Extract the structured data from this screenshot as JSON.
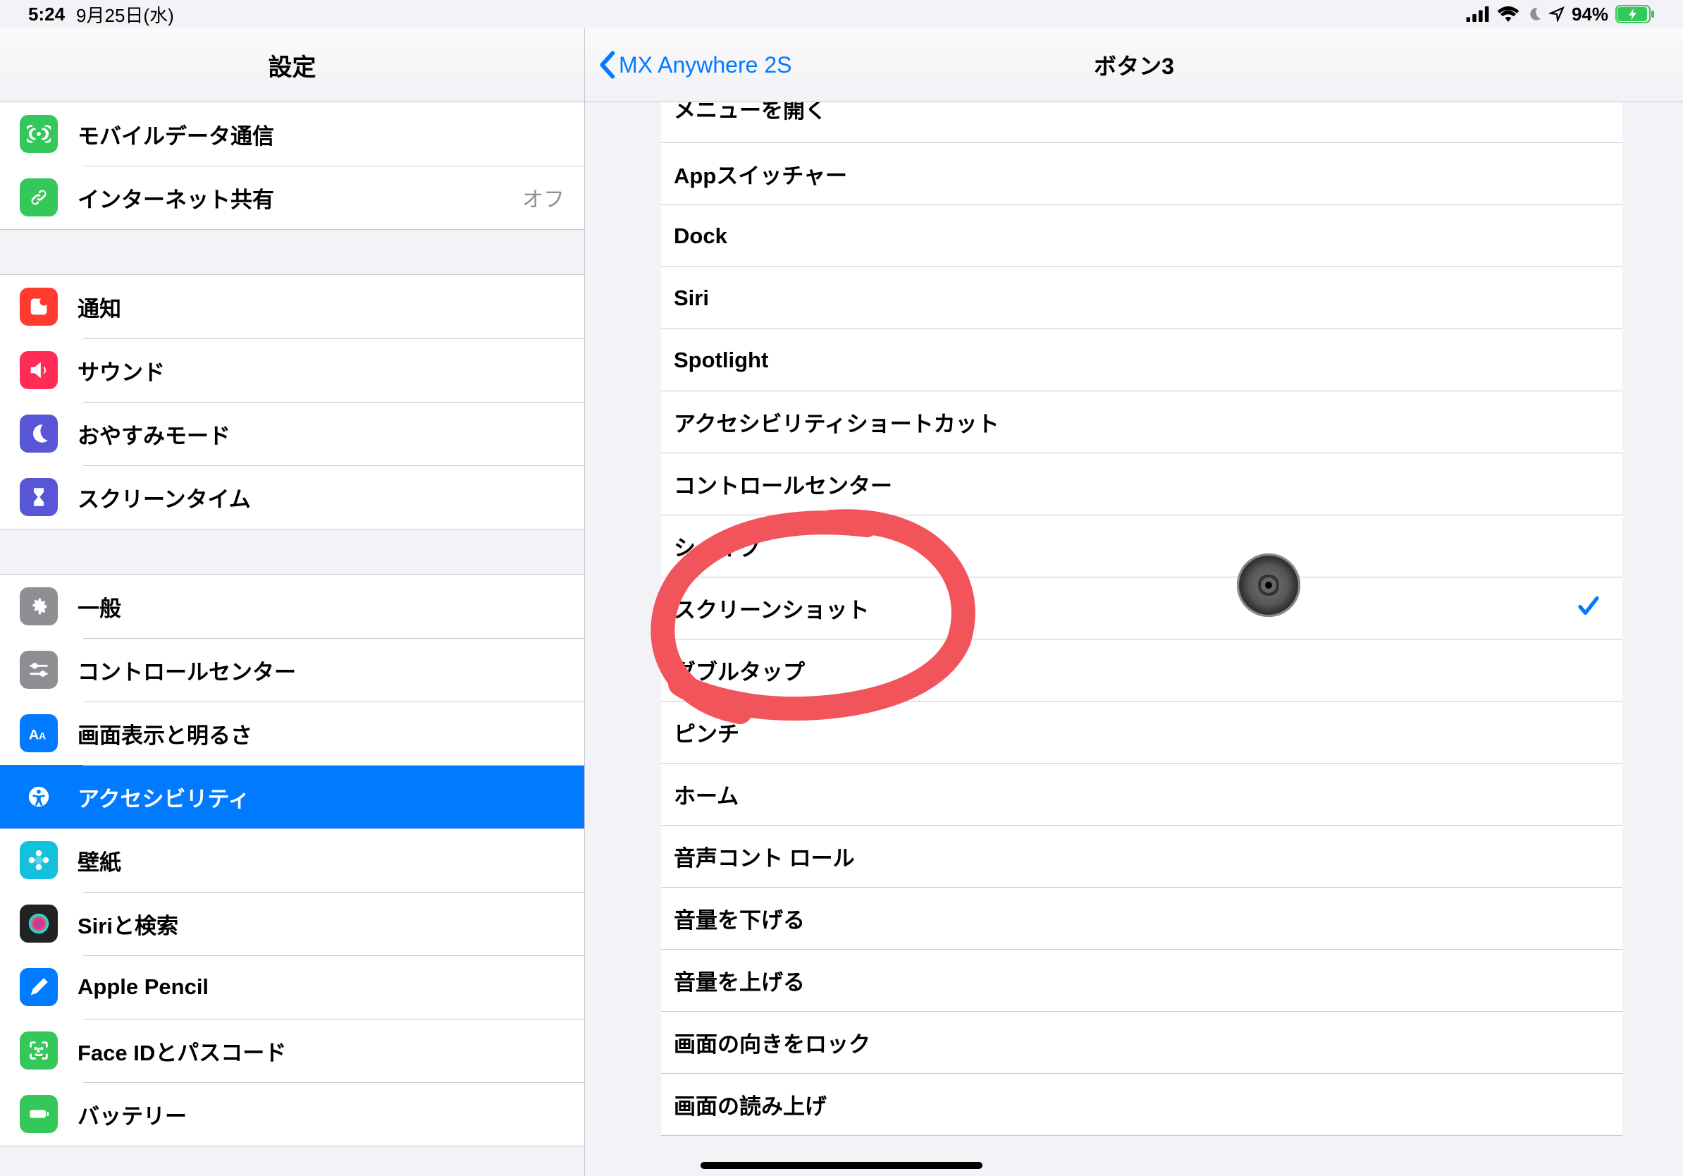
{
  "status": {
    "time": "5:24",
    "date": "9月25日(水)",
    "battery_pct": "94%"
  },
  "sidebar_title": "設定",
  "sidebar": {
    "g1": [
      {
        "id": "cellular",
        "label": "モバイルデータ通信",
        "value": "",
        "iconBg": "#34c759",
        "iconName": "antenna-icon"
      },
      {
        "id": "hotspot",
        "label": "インターネット共有",
        "value": "オフ",
        "iconBg": "#34c759",
        "iconName": "link-icon"
      }
    ],
    "g2": [
      {
        "id": "notifications",
        "label": "通知",
        "iconBg": "#ff3b30",
        "iconName": "bell-icon"
      },
      {
        "id": "sound",
        "label": "サウンド",
        "iconBg": "#ff2d55",
        "iconName": "speaker-icon"
      },
      {
        "id": "dnd",
        "label": "おやすみモード",
        "iconBg": "#5856d6",
        "iconName": "moon-icon"
      },
      {
        "id": "screentime",
        "label": "スクリーンタイム",
        "iconBg": "#5856d6",
        "iconName": "hourglass-icon"
      }
    ],
    "g3": [
      {
        "id": "general",
        "label": "一般",
        "iconBg": "#8e8e93",
        "iconName": "gear-icon"
      },
      {
        "id": "control",
        "label": "コントロールセンター",
        "iconBg": "#8e8e93",
        "iconName": "sliders-icon"
      },
      {
        "id": "display",
        "label": "画面表示と明るさ",
        "iconBg": "#007aff",
        "iconName": "text-size-icon"
      },
      {
        "id": "accessibility",
        "label": "アクセシビリティ",
        "iconBg": "#007aff",
        "iconName": "accessibility-icon",
        "selected": true
      },
      {
        "id": "wallpaper",
        "label": "壁紙",
        "iconBg": "#13c1dc",
        "iconName": "flower-icon"
      },
      {
        "id": "siri",
        "label": "Siriと検索",
        "iconBg": "#222",
        "iconName": "siri-icon"
      },
      {
        "id": "pencil",
        "label": "Apple Pencil",
        "iconBg": "#007aff",
        "iconName": "pencil-icon"
      },
      {
        "id": "faceid",
        "label": "Face IDとパスコード",
        "iconBg": "#34c759",
        "iconName": "faceid-icon"
      },
      {
        "id": "battery",
        "label": "バッテリー",
        "iconBg": "#34c759",
        "iconName": "battery-icon"
      }
    ]
  },
  "main_header": {
    "back_label": "MX Anywhere 2S",
    "title": "ボタン3"
  },
  "options": [
    {
      "label": "メニューを開く"
    },
    {
      "label": "Appスイッチャー"
    },
    {
      "label": "Dock"
    },
    {
      "label": "Siri"
    },
    {
      "label": "Spotlight"
    },
    {
      "label": "アクセシビリティショートカット"
    },
    {
      "label": "コントロールセンター"
    },
    {
      "label": "シェイク"
    },
    {
      "label": "スクリーンショット",
      "checked": true
    },
    {
      "label": "ダブルタップ"
    },
    {
      "label": "ピンチ"
    },
    {
      "label": "ホーム"
    },
    {
      "label": "音声コント ロール"
    },
    {
      "label": "音量を下げる"
    },
    {
      "label": "音量を上げる"
    },
    {
      "label": "画面の向きをロック"
    },
    {
      "label": "画面の読み上げ"
    }
  ]
}
